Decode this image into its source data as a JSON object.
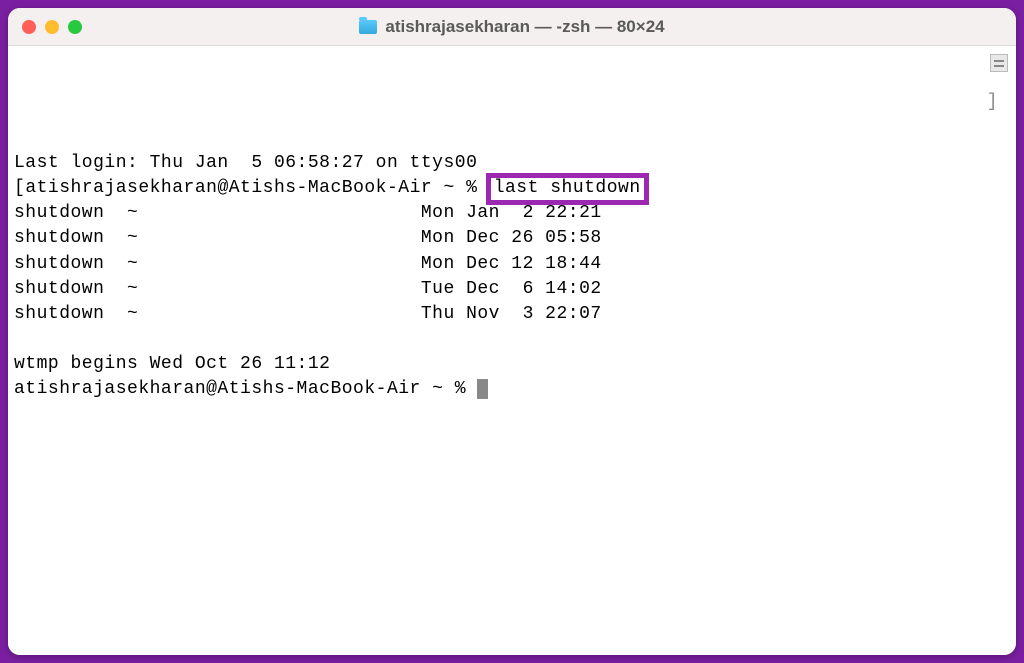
{
  "window": {
    "title": "atishrajasekharan — -zsh — 80×24"
  },
  "terminal": {
    "last_login": "Last login: Thu Jan  5 06:58:27 on ttys00",
    "bracket_char": "[",
    "prompt_line_1a": "atishrajasekharan@Atishs-MacBook-Air ~ %",
    "command_highlighted": "last shutdown",
    "output_lines": [
      "shutdown  ~                         Mon Jan  2 22:21",
      "shutdown  ~                         Mon Dec 26 05:58",
      "shutdown  ~                         Mon Dec 12 18:44",
      "shutdown  ~                         Tue Dec  6 14:02",
      "shutdown  ~                         Thu Nov  3 22:07"
    ],
    "wtmp_line": "wtmp begins Wed Oct 26 11:12",
    "prompt_line_2": "atishrajasekharan@Atishs-MacBook-Air ~ % ",
    "right_bracket": "]"
  }
}
